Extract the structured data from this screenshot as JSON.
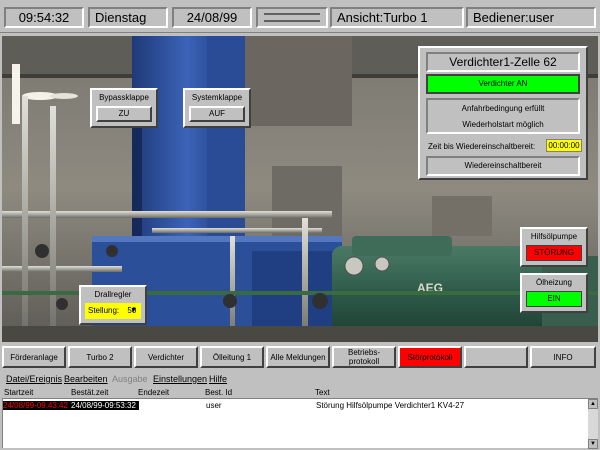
{
  "status": {
    "time": "09:54:32",
    "day": "Dienstag",
    "date": "24/08/99",
    "view": "Ansicht:Turbo 1",
    "user": "Bediener:user"
  },
  "bypass": {
    "title": "Bypassklappe",
    "state": "ZU"
  },
  "system": {
    "title": "Systemklappe",
    "state": "AUF"
  },
  "drall": {
    "title": "Drallregler",
    "label": "Stellung:",
    "value": "50"
  },
  "verdichter": {
    "title": "Verdichter1-Zelle 62",
    "status": "Verdichter AN",
    "cond1": "Anfahrbedingung erfüllt",
    "cond2": "Wiederholstart möglich",
    "timer_label": "Zeit bis Wiedereinschaltbereit:",
    "timer_value": "00:00:00",
    "ready": "Wiedereinschaltbereit"
  },
  "hilfsoel": {
    "title": "Hilfsölpumpe",
    "state": "STÖRUNG"
  },
  "oelheizung": {
    "title": "Ölheizung",
    "state": "EIN"
  },
  "nav": [
    "Förderanlage",
    "Turbo 2",
    "Verdichter",
    "Ölleitung 1",
    "Alle Meldungen",
    "Betriebs- protokoll",
    "Störprotokoll",
    "",
    "INFO"
  ],
  "menu": [
    "Datei/Ereignis",
    "Bearbeiten",
    "Ausgabe",
    "Einstellungen",
    "Hilfe"
  ],
  "events": {
    "headers": [
      "Startzeit",
      "Bestät.zeit",
      "Endezeit",
      "Best. Id",
      "Text"
    ],
    "rows": [
      [
        "24/08/99-09:43:42",
        "24/08/99-09:53:32",
        "",
        "user",
        "Störung Hilfsölpumpe Verdichter1 KV4-27"
      ]
    ]
  },
  "colors": {
    "green": "#00ff00",
    "red": "#ff0000",
    "yellow": "#ffff00",
    "panel": "#c0c0c0"
  }
}
